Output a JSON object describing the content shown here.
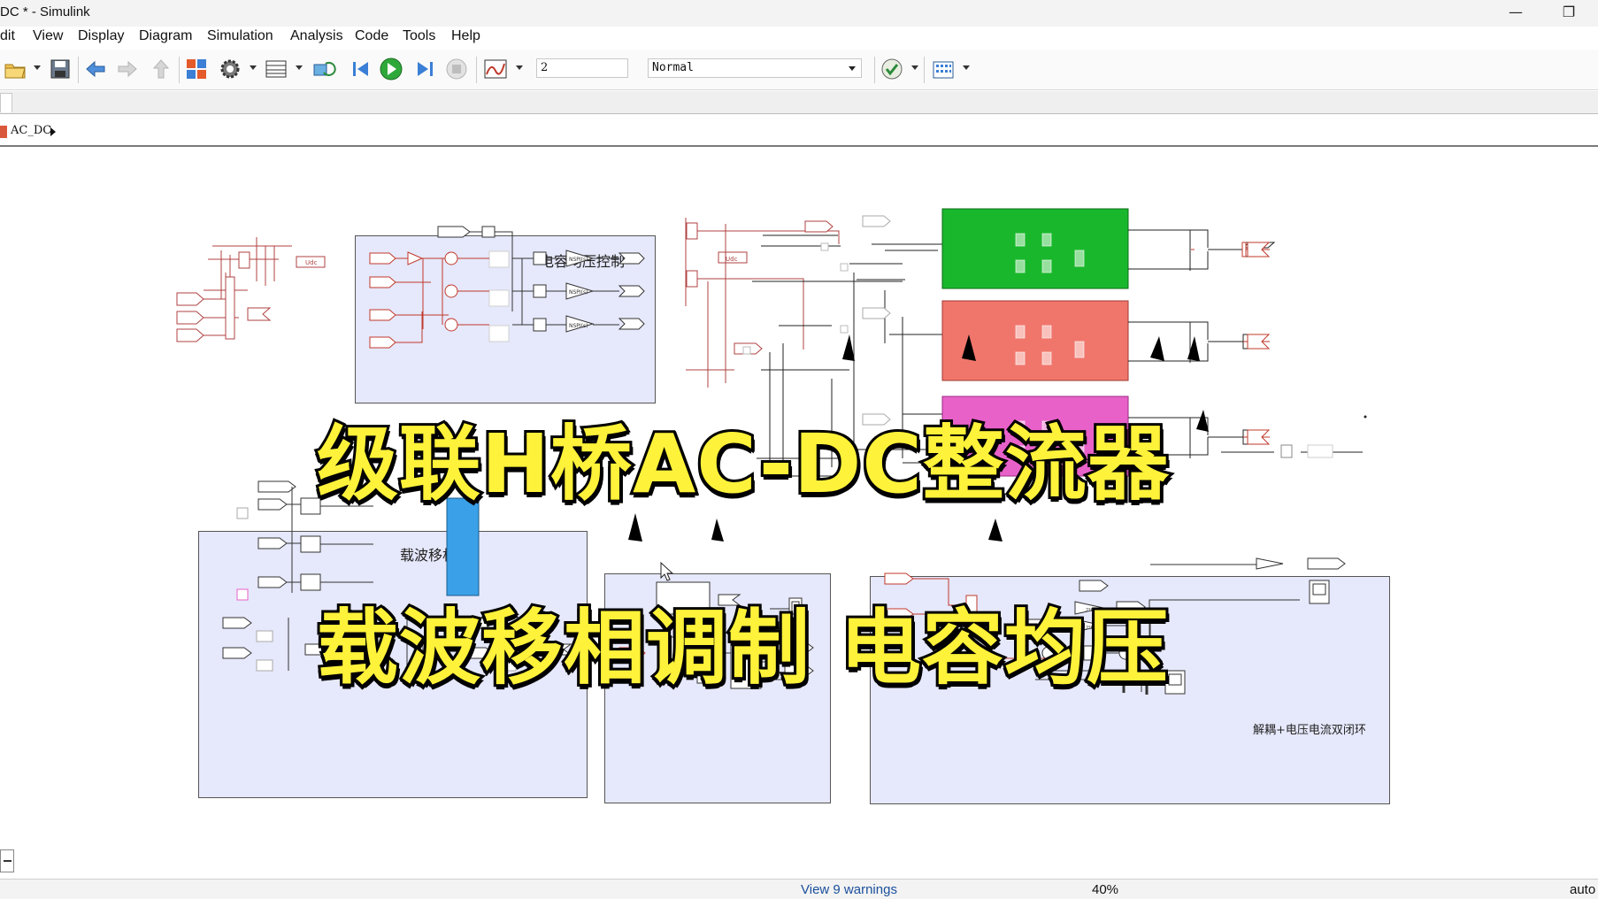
{
  "window": {
    "title": "DC * - Simulink",
    "minimize_glyph": "—",
    "restore_glyph": "❐"
  },
  "menu": {
    "items": [
      "dit",
      "View",
      "Display",
      "Diagram",
      "Simulation",
      "Analysis",
      "Code",
      "Tools",
      "Help"
    ]
  },
  "toolbar": {
    "icons": [
      "open-folder-icon",
      "save-icon",
      "back-arrow-icon",
      "forward-arrow-icon",
      "up-arrow-icon",
      "library-browser-icon",
      "model-settings-gear-icon",
      "model-explorer-icon",
      "update-diagram-icon",
      "step-back-icon",
      "run-icon",
      "step-forward-icon",
      "stop-icon",
      "data-inspector-icon",
      "model-advisor-check-icon",
      "performance-grid-icon"
    ],
    "stop_time": "2",
    "sim_mode": "Normal"
  },
  "breadcrumb": {
    "model": "AC_DC"
  },
  "diagram": {
    "subsystem_labels": {
      "capacitor_balance": "电容均压控制",
      "carrier_phase_shift": "载波移相",
      "decoupling_loop": "解耦+电压电流双闭环"
    },
    "block_colors": {
      "background": "#e6e8fb",
      "h_bridge_1": "#19b82c",
      "h_bridge_2": "#f0766b",
      "h_bridge_3": "#e861c9",
      "carrier_highlight": "#3aa0e8"
    },
    "small_tags": {
      "udc": "Udc",
      "udc2": "Udc",
      "pi": "NSPI(s)"
    }
  },
  "overlay": {
    "line1": "级联H桥AC-DC整流器",
    "line2": "载波移相调制  电容均压",
    "text_color": "#fff23a"
  },
  "status": {
    "warnings": "View 9 warnings",
    "zoom": "40%",
    "solver": "auto"
  }
}
